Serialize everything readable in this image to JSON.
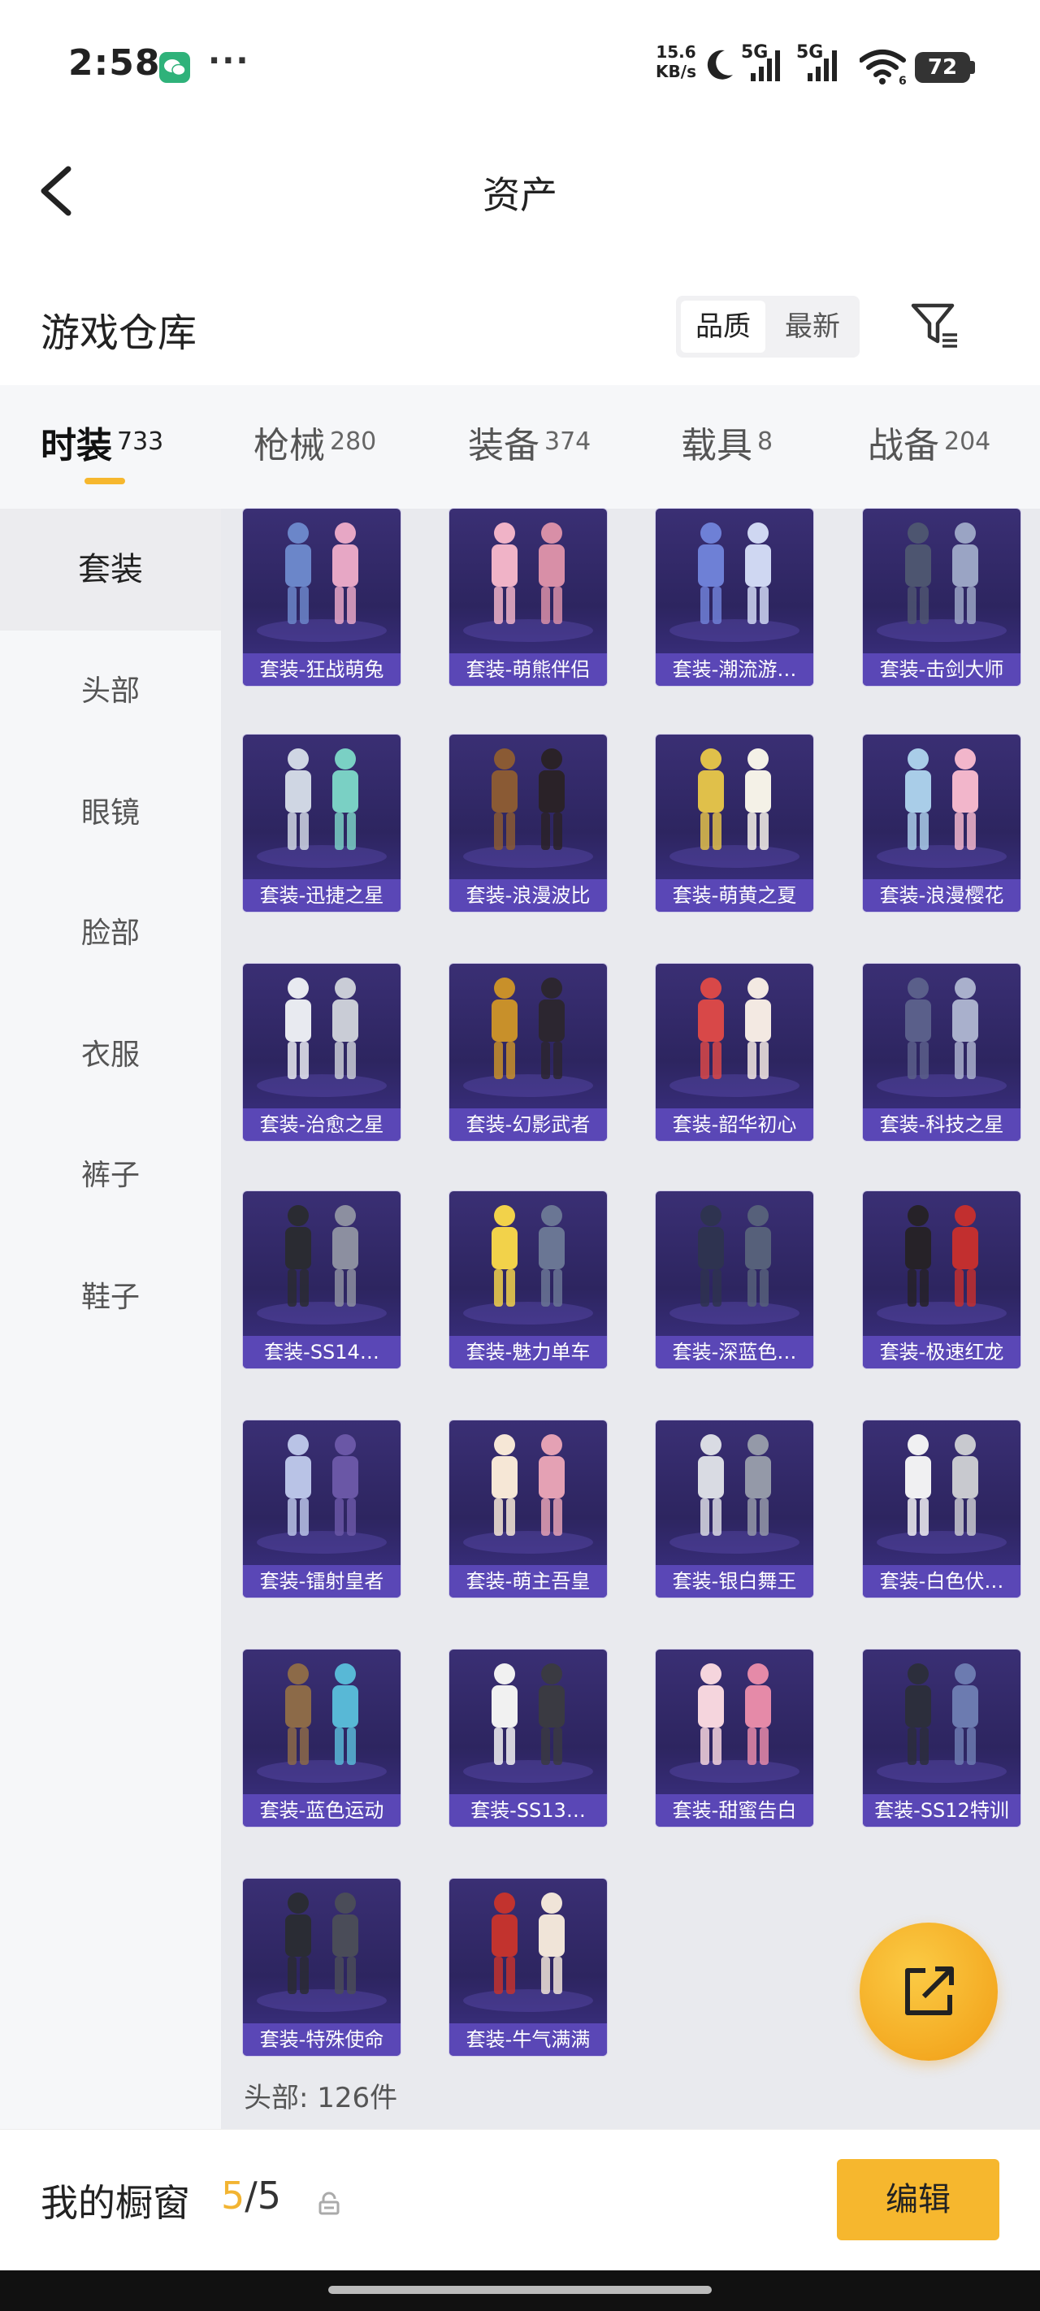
{
  "status_bar": {
    "time": "2:58",
    "more": "···",
    "net_speed_value": "15.6",
    "net_speed_unit": "KB/s",
    "signal1": "5G",
    "signal2": "5G",
    "wifi_sub": "6",
    "battery": "72"
  },
  "nav": {
    "title": "资产"
  },
  "section": {
    "title": "游戏仓库",
    "sort_options": [
      "品质",
      "最新"
    ],
    "selected_sort": "品质"
  },
  "category_tabs": [
    {
      "label": "时装",
      "count": "733",
      "active": true
    },
    {
      "label": "枪械",
      "count": "280"
    },
    {
      "label": "装备",
      "count": "374"
    },
    {
      "label": "载具",
      "count": "8"
    },
    {
      "label": "战备",
      "count": "204"
    }
  ],
  "sidebar": {
    "items": [
      {
        "label": "套装",
        "active": true
      },
      {
        "label": "头部"
      },
      {
        "label": "眼镜"
      },
      {
        "label": "脸部"
      },
      {
        "label": "衣服"
      },
      {
        "label": "裤子"
      },
      {
        "label": "鞋子"
      }
    ]
  },
  "items": [
    {
      "label": "套装-狂战萌兔"
    },
    {
      "label": "套装-萌熊伴侣"
    },
    {
      "label": "套装-潮流游…"
    },
    {
      "label": "套装-击剑大师"
    },
    {
      "label": "套装-迅捷之星"
    },
    {
      "label": "套装-浪漫波比"
    },
    {
      "label": "套装-萌黄之夏"
    },
    {
      "label": "套装-浪漫樱花"
    },
    {
      "label": "套装-治愈之星"
    },
    {
      "label": "套装-幻影武者"
    },
    {
      "label": "套装-韶华初心"
    },
    {
      "label": "套装-科技之星"
    },
    {
      "label": "套装-SS14…"
    },
    {
      "label": "套装-魅力单车"
    },
    {
      "label": "套装-深蓝色…"
    },
    {
      "label": "套装-极速红龙"
    },
    {
      "label": "套装-镭射皇者"
    },
    {
      "label": "套装-萌主吾皇"
    },
    {
      "label": "套装-银白舞王"
    },
    {
      "label": "套装-白色伏…"
    },
    {
      "label": "套装-蓝色运动"
    },
    {
      "label": "套装-SS13…"
    },
    {
      "label": "套装-甜蜜告白"
    },
    {
      "label": "套装-SS12特训"
    },
    {
      "label": "套装-特殊使命"
    },
    {
      "label": "套装-牛气满满"
    }
  ],
  "grid_footer": "头部: 126件",
  "showcase": {
    "label": "我的橱窗",
    "current": "5",
    "sep_total": "/5",
    "edit_label": "编辑"
  },
  "colors": {
    "accent": "#f6b72e",
    "card_bg": "#2d2560",
    "card_label_bg": "#5a47b6"
  }
}
